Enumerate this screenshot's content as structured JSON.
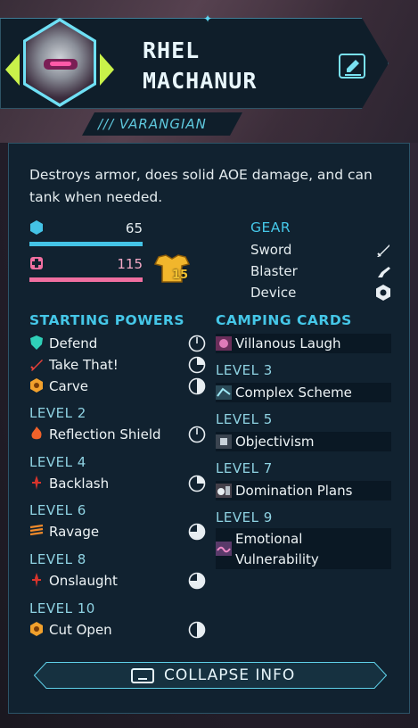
{
  "character": {
    "first_name": "RHEL",
    "last_name": "MACHANUR",
    "class_tag": "/// VARANGIAN",
    "description": "Destroys armor, does solid AOE damage, and can tank when needed."
  },
  "stats": {
    "shield": {
      "value": "65",
      "icon": "shield-icon",
      "color": "#44c3e6"
    },
    "health": {
      "value": "115",
      "icon": "health-cross-icon",
      "color": "#f06fa0"
    },
    "armor": {
      "value": "15",
      "icon": "armor-icon",
      "color": "#f1b62c"
    }
  },
  "gear": {
    "title": "GEAR",
    "items": [
      {
        "label": "Sword",
        "icon": "sword-icon"
      },
      {
        "label": "Blaster",
        "icon": "blaster-icon"
      },
      {
        "label": "Device",
        "icon": "device-icon"
      }
    ]
  },
  "powers": {
    "title": "STARTING POWERS",
    "starting": [
      {
        "name": "Defend",
        "icon": "defend-icon",
        "cooldown": "clock-1-icon"
      },
      {
        "name": "Take That!",
        "icon": "take-that-icon",
        "cooldown": "clock-2-icon"
      },
      {
        "name": "Carve",
        "icon": "carve-icon",
        "cooldown": "clock-3-icon"
      }
    ],
    "levels": [
      {
        "level": "LEVEL 2",
        "name": "Reflection Shield",
        "icon": "reflection-shield-icon",
        "cooldown": "clock-1-icon"
      },
      {
        "level": "LEVEL 4",
        "name": "Backlash",
        "icon": "backlash-icon",
        "cooldown": "clock-2-icon"
      },
      {
        "level": "LEVEL 6",
        "name": "Ravage",
        "icon": "ravage-icon",
        "cooldown": "clock-4-icon"
      },
      {
        "level": "LEVEL 8",
        "name": "Onslaught",
        "icon": "onslaught-icon",
        "cooldown": "clock-4-icon"
      },
      {
        "level": "LEVEL 10",
        "name": "Cut Open",
        "icon": "cut-open-icon",
        "cooldown": "clock-3-icon"
      }
    ]
  },
  "cards": {
    "title": "CAMPING CARDS",
    "starting": [
      {
        "name": "Villanous Laugh",
        "icon": "villanous-laugh-icon"
      }
    ],
    "levels": [
      {
        "level": "LEVEL 3",
        "name": "Complex Scheme",
        "icon": "complex-scheme-icon"
      },
      {
        "level": "LEVEL 5",
        "name": "Objectivism",
        "icon": "objectivism-icon"
      },
      {
        "level": "LEVEL 7",
        "name": "Domination Plans",
        "icon": "domination-plans-icon"
      },
      {
        "level": "LEVEL 9",
        "name": "Emotional Vulnerability",
        "name_line1": "Emotional",
        "name_line2": "Vulnerability",
        "icon": "emotional-vulnerability-icon"
      }
    ]
  },
  "footer": {
    "collapse_label": "COLLAPSE INFO",
    "icon": "collapse-icon"
  }
}
